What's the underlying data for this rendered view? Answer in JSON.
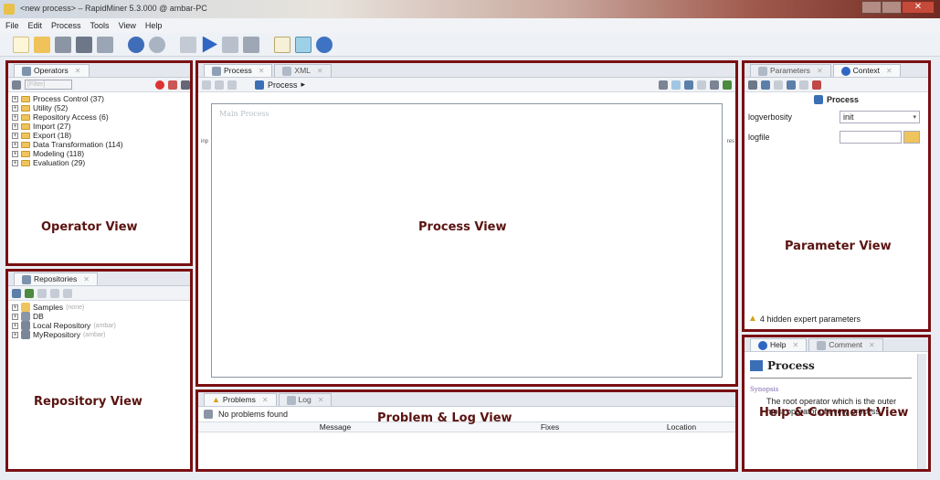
{
  "window": {
    "title": "<new process> – RapidMiner 5.3.000 @ ambar-PC"
  },
  "menu": [
    "File",
    "Edit",
    "Process",
    "Tools",
    "View",
    "Help"
  ],
  "operators": {
    "tab": "Operators",
    "filter_placeholder": "[Filter]",
    "items": [
      "Process Control (37)",
      "Utility (52)",
      "Repository Access (6)",
      "Import (27)",
      "Export (18)",
      "Data Transformation (114)",
      "Modeling (118)",
      "Evaluation (29)"
    ],
    "view_label": "Operator View"
  },
  "repositories": {
    "tab": "Repositories",
    "items": [
      {
        "label": "Samples",
        "note": "(none)"
      },
      {
        "label": "DB",
        "note": ""
      },
      {
        "label": "Local Repository",
        "note": "(ambar)"
      },
      {
        "label": "MyRepository",
        "note": "(ambar)"
      }
    ],
    "view_label": "Repository View"
  },
  "process": {
    "tabs": [
      "Process",
      "XML"
    ],
    "breadcrumb": "Process",
    "canvas_title": "Main Process",
    "left_port": "inp",
    "right_port": "res",
    "view_label": "Process View"
  },
  "problems": {
    "tabs": [
      "Problems",
      "Log"
    ],
    "status": "No problems found",
    "columns": [
      "Message",
      "Fixes",
      "Location"
    ],
    "view_label": "Problem & Log View"
  },
  "parameters": {
    "tabs": [
      "Parameters",
      "Context"
    ],
    "heading": "Process",
    "logverbosity_label": "logverbosity",
    "logverbosity_value": "init",
    "logfile_label": "logfile",
    "hidden_note": "4 hidden expert parameters",
    "view_label": "Parameter View"
  },
  "help": {
    "tabs": [
      "Help",
      "Comment"
    ],
    "heading": "Process",
    "synopsis_label": "Synopsis",
    "text": "The root operator which is the outer most operator of every process.",
    "view_label": "Help & Comment View"
  },
  "colors": {
    "annotation_border": "#7a0f12",
    "annotation_text": "#5a1411"
  }
}
